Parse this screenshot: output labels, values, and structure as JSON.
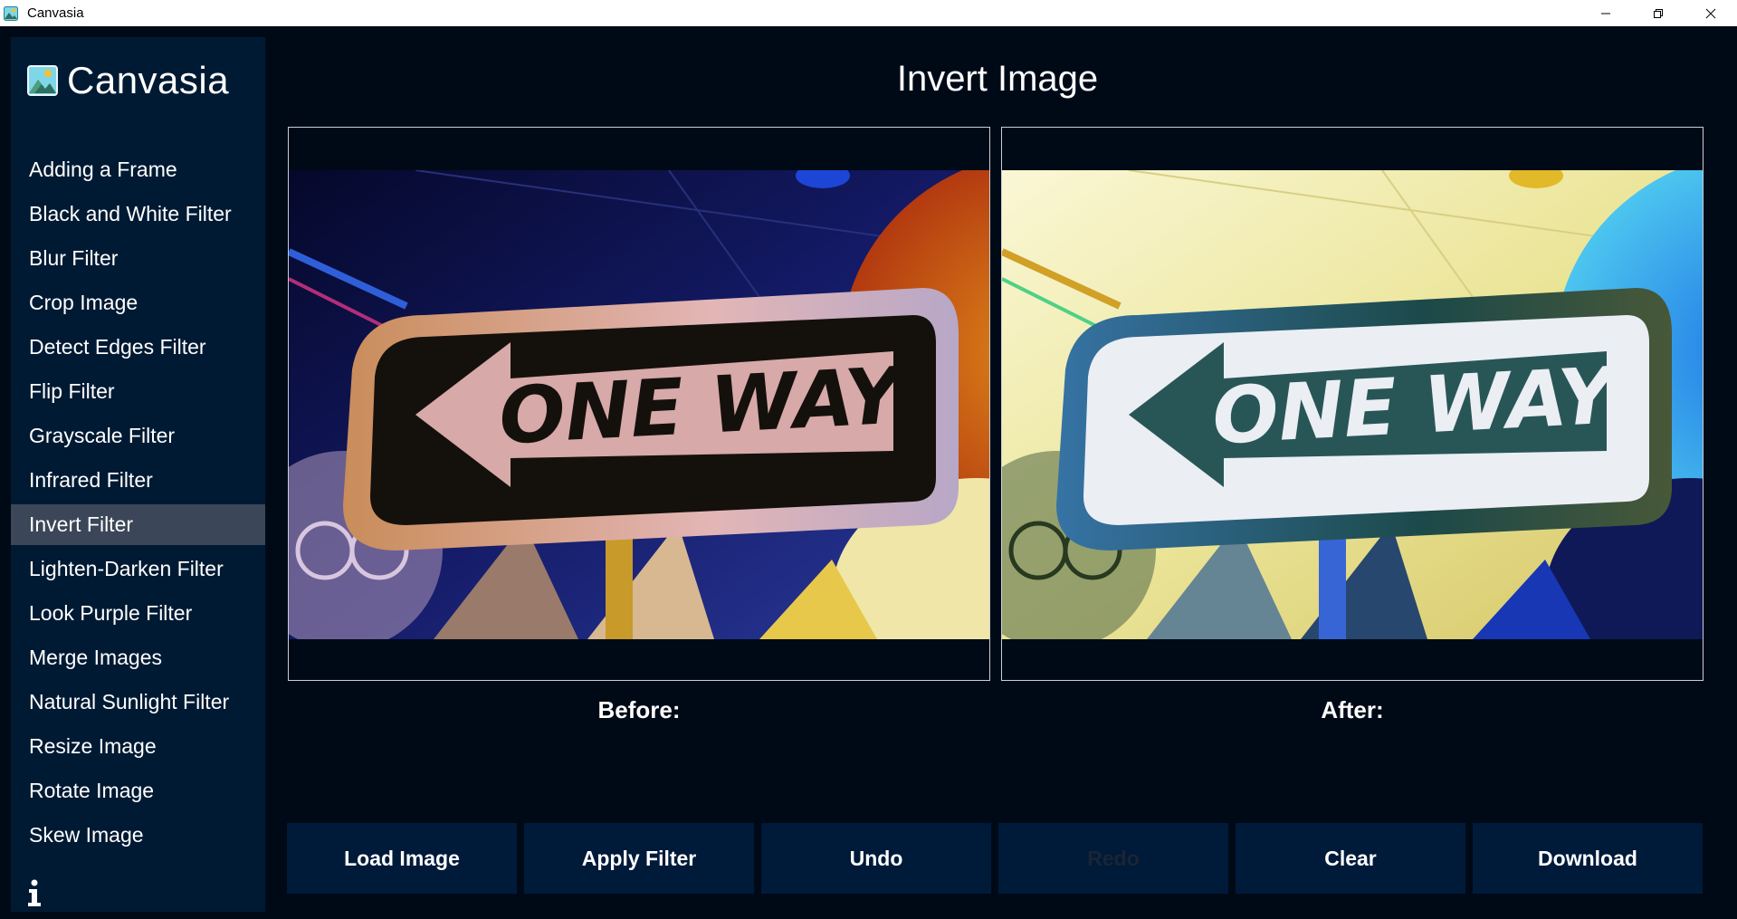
{
  "window": {
    "title": "Canvasia",
    "minimize_icon": "minimize-icon",
    "restore_icon": "restore-icon",
    "close_icon": "close-icon"
  },
  "sidebar": {
    "brand": "Canvasia",
    "items": [
      {
        "label": "Adding a Frame",
        "active": false
      },
      {
        "label": "Black and White Filter",
        "active": false
      },
      {
        "label": "Blur Filter",
        "active": false
      },
      {
        "label": "Crop Image",
        "active": false
      },
      {
        "label": "Detect Edges Filter",
        "active": false
      },
      {
        "label": "Flip Filter",
        "active": false
      },
      {
        "label": "Grayscale Filter",
        "active": false
      },
      {
        "label": "Infrared Filter",
        "active": false
      },
      {
        "label": "Invert Filter",
        "active": true
      },
      {
        "label": "Lighten-Darken Filter",
        "active": false
      },
      {
        "label": "Look Purple Filter",
        "active": false
      },
      {
        "label": "Merge Images",
        "active": false
      },
      {
        "label": "Natural Sunlight Filter",
        "active": false
      },
      {
        "label": "Resize Image",
        "active": false
      },
      {
        "label": "Rotate Image",
        "active": false
      },
      {
        "label": "Skew Image",
        "active": false
      }
    ],
    "info_icon": "info-icon"
  },
  "main": {
    "title": "Invert Image",
    "before": {
      "label": "Before:",
      "sign_text": "ONE WAY"
    },
    "after": {
      "label": "After:",
      "sign_text": "ONE WAY"
    },
    "buttons": [
      {
        "label": "Load Image",
        "enabled": true
      },
      {
        "label": "Apply Filter",
        "enabled": true
      },
      {
        "label": "Undo",
        "enabled": true
      },
      {
        "label": "Redo",
        "enabled": false
      },
      {
        "label": "Clear",
        "enabled": true
      },
      {
        "label": "Download",
        "enabled": true
      }
    ]
  },
  "colors": {
    "background": "#000a17",
    "sidebar": "#001a33",
    "active_item": "#3b4658",
    "button": "#001a3a",
    "text": "#ffffff"
  }
}
